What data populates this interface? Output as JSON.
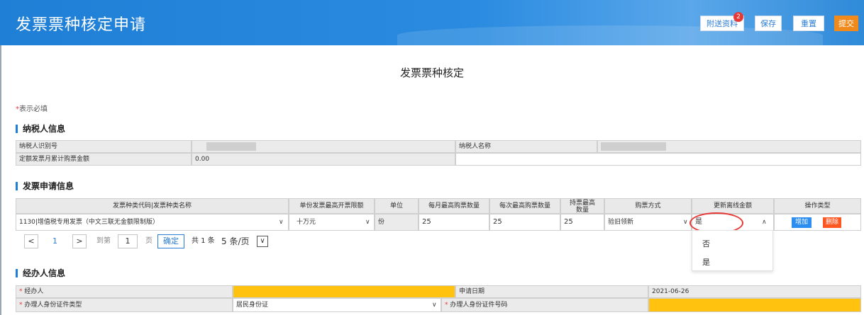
{
  "header": {
    "title": "发票票种核定申请",
    "buttons": [
      "附送资料",
      "保存",
      "重置",
      "提交"
    ],
    "badge_count": "2"
  },
  "page_heading": "发票票种核定",
  "required_note": {
    "star": "*",
    "text": "表示必填"
  },
  "sections": {
    "taxpayer": "纳税人信息",
    "application": "发票申请信息",
    "handler": "经办人信息"
  },
  "taxpayer": {
    "id_label": "纳税人识别号",
    "name_label": "纳税人名称",
    "quota_label": "定额发票月累计购票金额",
    "quota_value": "0.00"
  },
  "table": {
    "headers": [
      "发票种类代码|发票种类名称",
      "单份发票最高开票限额",
      "单位",
      "每月最高购票数量",
      "每次最高购票数量",
      "持票最高数量",
      "购票方式",
      "更新离线金额",
      "操作类型"
    ],
    "row": {
      "invoice_type": "1130|增值税专用发票（中文三联无金额限制版）",
      "limit": "十万元",
      "unit": "份",
      "monthly_max": "25",
      "per_time_max": "25",
      "hold_max": "25",
      "method": "验旧领新",
      "update_offline": "是",
      "add_label": "增加",
      "delete_label": "删除"
    }
  },
  "pager": {
    "prev": "<",
    "current": "1",
    "next": ">",
    "goto_label": "到第",
    "goto_value": "1",
    "page_label": "页",
    "confirm": "确定",
    "total": "共 1 条",
    "page_size": "5 条/页"
  },
  "dropdown": {
    "options": [
      "否",
      "是"
    ]
  },
  "handler": {
    "handler_label": "经办人",
    "date_label": "申请日期",
    "date_value": "2021-06-26",
    "idtype_label": "办理人身份证件类型",
    "idtype_value": "居民身份证",
    "idno_label": "办理人身份证件号码",
    "star": "*"
  },
  "icons": {
    "select": "chevron-down-icon",
    "select_open": "chevron-up-icon"
  },
  "colors": {
    "brand_blue": "#1f7fd6",
    "required_yellow": "#ffc20e",
    "danger": "#e53935",
    "add_blue": "#2b8ef0",
    "delete_orange": "#ff5722"
  }
}
